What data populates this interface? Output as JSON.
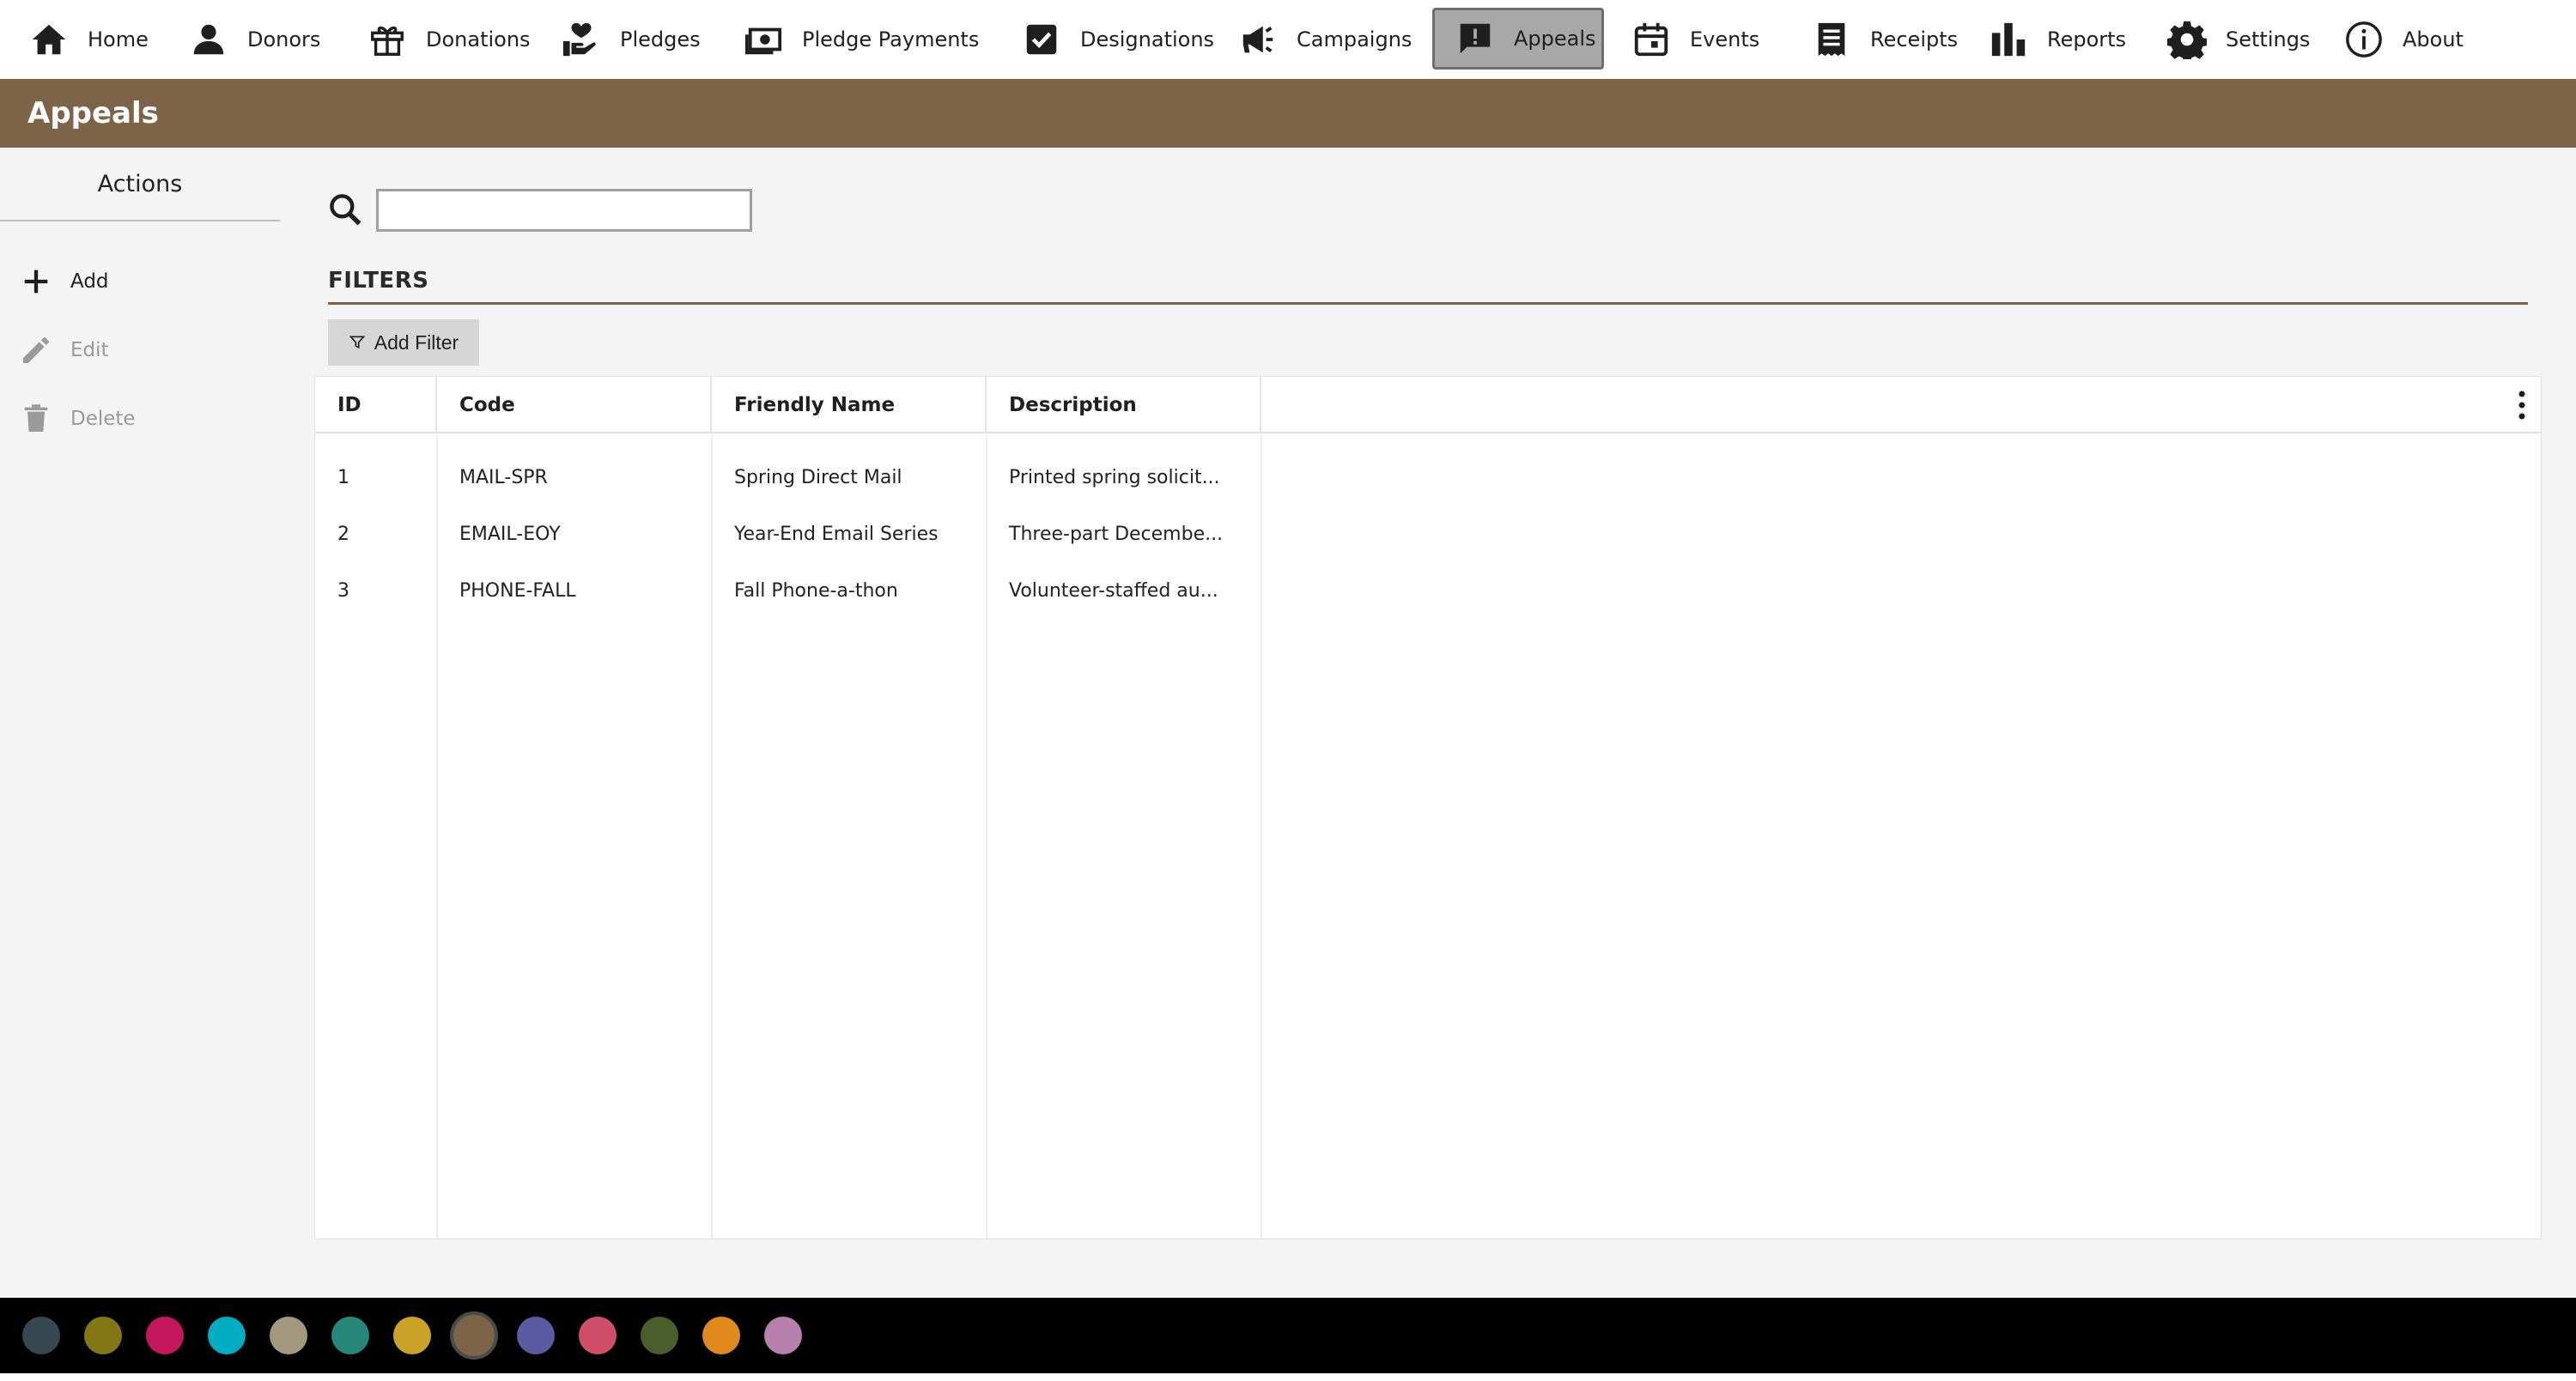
{
  "nav": [
    {
      "label": "Home",
      "icon": "home-icon"
    },
    {
      "label": "Donors",
      "icon": "person-icon"
    },
    {
      "label": "Donations",
      "icon": "gift-icon"
    },
    {
      "label": "Pledges",
      "icon": "hand-heart-icon"
    },
    {
      "label": "Pledge Payments",
      "icon": "cash-icon"
    },
    {
      "label": "Designations",
      "icon": "checkbox-icon"
    },
    {
      "label": "Campaigns",
      "icon": "megaphone-icon"
    },
    {
      "label": "Appeals",
      "icon": "alert-message-icon",
      "active": true
    },
    {
      "label": "Events",
      "icon": "calendar-icon"
    },
    {
      "label": "Receipts",
      "icon": "receipt-icon"
    },
    {
      "label": "Reports",
      "icon": "bar-chart-icon"
    },
    {
      "label": "Settings",
      "icon": "gear-icon"
    },
    {
      "label": "About",
      "icon": "info-icon"
    }
  ],
  "page": {
    "title": "Appeals"
  },
  "sidebar": {
    "heading": "Actions",
    "actions": [
      {
        "label": "Add",
        "icon": "plus-icon",
        "enabled": true
      },
      {
        "label": "Edit",
        "icon": "pencil-icon",
        "enabled": false
      },
      {
        "label": "Delete",
        "icon": "trash-icon",
        "enabled": false
      }
    ]
  },
  "search": {
    "value": "",
    "placeholder": ""
  },
  "filters": {
    "label": "FILTERS",
    "add_label": "Add Filter"
  },
  "grid": {
    "columns": [
      "ID",
      "Code",
      "Friendly Name",
      "Description"
    ],
    "rows": [
      [
        "1",
        "MAIL-SPR",
        "Spring Direct Mail",
        "Printed spring solicit..."
      ],
      [
        "2",
        "EMAIL-EOY",
        "Year-End Email Series",
        "Three-part Decembe..."
      ],
      [
        "3",
        "PHONE-FALL",
        "Fall Phone-a-thon",
        "Volunteer-staffed au..."
      ]
    ]
  },
  "colors": {
    "accent": "#7d6449",
    "palette": [
      "#37474f",
      "#827717",
      "#c2185b",
      "#00acc1",
      "#a1987e",
      "#26867a",
      "#c9a227",
      "#7d6449",
      "#5c5aa0",
      "#cf4f6b",
      "#4b5d2a",
      "#e08a1e",
      "#b77fae"
    ],
    "palette_selected": 7
  }
}
